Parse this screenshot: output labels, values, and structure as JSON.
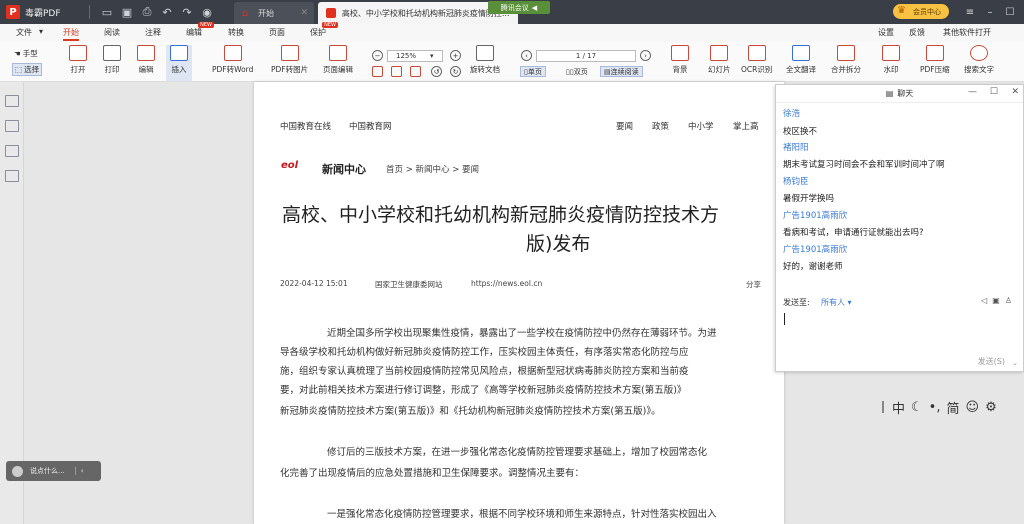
{
  "titlebar": {
    "app_name": "毒霸PDF",
    "tab_home": "开始",
    "tab_doc": "高校、中小学校和托幼机构新冠肺炎疫情防控...",
    "meeting": "腾讯会议",
    "vip": "会员中心"
  },
  "menu": {
    "file": "文件",
    "start": "开始",
    "read": "阅读",
    "annotate": "注释",
    "edit": "编辑",
    "convert": "转换",
    "page": "页面",
    "protect": "保护",
    "new_badge": "NEW",
    "settings": "设置",
    "feedback": "反馈",
    "other_open": "其他软件打开"
  },
  "ribbon": {
    "hand": "手型",
    "select": "选择",
    "open": "打开",
    "print": "打印",
    "edit": "编辑",
    "insert": "插入",
    "pdf2word": "PDF转Word",
    "pdf2img": "PDF转图片",
    "page_edit": "页面编辑",
    "zoom": "125%",
    "rotate_doc": "旋转文档",
    "page_no": "1 / 17",
    "single": "单页",
    "double": "双页",
    "continuous": "连续阅读",
    "background": "背景",
    "slideshow": "幻灯片",
    "ocr": "OCR识别",
    "translate": "全文翻译",
    "merge_split": "合并拆分",
    "watermark": "水印",
    "compress": "PDF压缩",
    "search": "搜索文字"
  },
  "chat_mini": {
    "placeholder": "说点什么..."
  },
  "doc": {
    "nav1": "中国教育在线",
    "nav2": "中国教育网",
    "nav3": "要闻",
    "nav4": "政策",
    "nav5": "中小学",
    "nav6": "掌上高",
    "logo": "eol",
    "news_center": "新闻中心",
    "breadcrumb": "首页 > 新闻中心 > 要闻",
    "title_line1": "高校、中小学校和托幼机构新冠肺炎疫情防控技术方",
    "title_line2": "版)发布",
    "date": "2022-04-12 15:01",
    "source": "国家卫生健康委网站",
    "url": "https://news.eol.cn",
    "share": "分享",
    "p1_l1": "近期全国多所学校出现聚集性疫情，暴露出了一些学校在疫情防控中仍然存在薄弱环节。为进",
    "p1_l2": "导各级学校和托幼机构做好新冠肺炎疫情防控工作，压实校园主体责任，有序落实常态化防控与应",
    "p1_l3": "施，组织专家认真梳理了当前校园疫情防控常见风险点，根据新型冠状病毒肺炎防控方案和当前疫",
    "p1_l4": "要，对此前相关技术方案进行修订调整，形成了《高等学校新冠肺炎疫情防控技术方案(第五版)》",
    "p1_l5": "新冠肺炎疫情防控技术方案(第五版)》和《托幼机构新冠肺炎疫情防控技术方案(第五版)》。",
    "p2_l1": "修订后的三版技术方案，在进一步强化常态化疫情防控管理要求基础上，增加了校园常态化",
    "p2_l2": "化完善了出现疫情后的应急处置措施和卫生保障要求。调整情况主要有：",
    "p3_l1": "一是强化常态化疫情防控管理要求，根据不同学校环境和师生来源特点，针对性落实校园出入"
  },
  "chat": {
    "title": "聊天",
    "messages": [
      {
        "name": "徐浩",
        "text": "校区换不"
      },
      {
        "name": "褚阳阳",
        "text": "期末考试复习时间会不会和军训时间冲了啊"
      },
      {
        "name": "杨钧臣",
        "text": "暑假开学换吗"
      },
      {
        "name": "广告1901高雨欣",
        "text": "看病和考试，申请通行证就能出去吗?"
      },
      {
        "name": "广告1901高雨欣",
        "text": "好的，谢谢老师"
      }
    ],
    "send_to_label": "发送至:",
    "recipient": "所有人",
    "send_button": "发送(S)"
  },
  "ime": {
    "lang": "中",
    "punct": "简"
  },
  "colors": {
    "accent_red": "#d83b1f",
    "link_blue": "#3a7bd5",
    "titlebar_bg": "#3a3f47"
  }
}
